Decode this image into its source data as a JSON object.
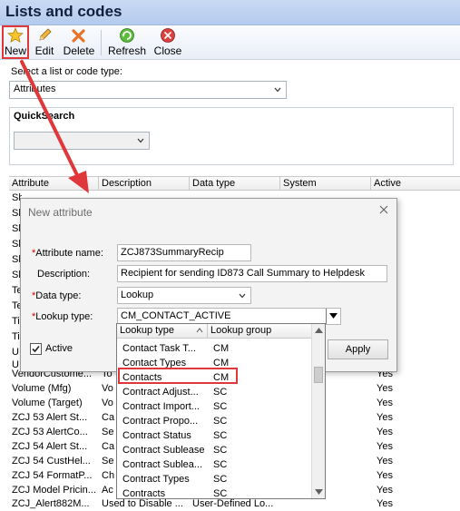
{
  "window": {
    "title": "Lists and codes"
  },
  "toolbar": {
    "new_label": "New",
    "edit_label": "Edit",
    "delete_label": "Delete",
    "refresh_label": "Refresh",
    "close_label": "Close",
    "icons": {
      "new": "star-icon",
      "edit": "pencil-icon",
      "delete": "cross-icon",
      "refresh": "refresh-icon",
      "close": "close-circle-icon"
    }
  },
  "selector": {
    "label": "Select a list or code type:",
    "value": "Attributes"
  },
  "quicksearch": {
    "title": "QuickSearch",
    "value": ""
  },
  "grid": {
    "columns": [
      "Attribute",
      "Description",
      "Data type",
      "System",
      "Active"
    ],
    "partial_rows": [
      {
        "attribute": "Sh",
        "description": ""
      },
      {
        "attribute": "Sh",
        "description": ""
      },
      {
        "attribute": "Sh",
        "description": ""
      },
      {
        "attribute": "Sh",
        "description": ""
      },
      {
        "attribute": "Sh",
        "description": ""
      },
      {
        "attribute": "Sh",
        "description": ""
      },
      {
        "attribute": "Te",
        "description": ""
      },
      {
        "attribute": "Te",
        "description": ""
      },
      {
        "attribute": "Ti",
        "description": ""
      },
      {
        "attribute": "Ti",
        "description": ""
      },
      {
        "attribute": "U",
        "description": ""
      },
      {
        "attribute": "U",
        "description": ""
      }
    ],
    "rows": [
      {
        "attribute": "VendorCustome...",
        "description": "To",
        "data_type": "",
        "system": "",
        "active": "Yes"
      },
      {
        "attribute": "Volume (Mfg)",
        "description": "Vo",
        "data_type": "",
        "system": "",
        "active": "Yes"
      },
      {
        "attribute": "Volume (Target)",
        "description": "Vo",
        "data_type": "",
        "system": "",
        "active": "Yes"
      },
      {
        "attribute": "ZCJ 53 Alert St...",
        "description": "Ca",
        "data_type": "",
        "system": "",
        "active": "Yes"
      },
      {
        "attribute": "ZCJ 53 AlertCo...",
        "description": "Se",
        "data_type": "",
        "system": "",
        "active": "Yes"
      },
      {
        "attribute": "ZCJ 54 Alert St...",
        "description": "Ca",
        "data_type": "",
        "system": "",
        "active": "Yes"
      },
      {
        "attribute": "ZCJ 54 CustHel...",
        "description": "Se",
        "data_type": "",
        "system": "",
        "active": "Yes"
      },
      {
        "attribute": "ZCJ 54 FormatP...",
        "description": "Ch",
        "data_type": "",
        "system": "",
        "active": "Yes"
      },
      {
        "attribute": "ZCJ Model Pricin...",
        "description": "Ac",
        "data_type": "",
        "system": "",
        "active": "Yes"
      },
      {
        "attribute": "ZCJ_Alert882M...",
        "description": "Used to Disable ...",
        "data_type": "User-Defined Lo...",
        "system": "",
        "active": "Yes"
      }
    ]
  },
  "dialog": {
    "title": "New attribute",
    "attribute_name_label": "Attribute name:",
    "attribute_name_value": "ZCJ873SummaryRecip",
    "description_label": "Description:",
    "description_value": "Recipient for sending ID873 Call Summary to Helpdesk",
    "data_type_label": "Data type:",
    "data_type_value": "Lookup",
    "lookup_type_label": "Lookup type:",
    "lookup_type_value": "CM_CONTACT_ACTIVE",
    "active_label": "Active",
    "active_checked": true,
    "apply_label": "Apply"
  },
  "lookup_list": {
    "columns": [
      "Lookup type",
      "Lookup group"
    ],
    "rows": [
      {
        "type": "Contact Task T...",
        "group": "CM"
      },
      {
        "type": "Contact Types",
        "group": "CM"
      },
      {
        "type": "Contacts",
        "group": "CM"
      },
      {
        "type": "Contract Adjust...",
        "group": "SC"
      },
      {
        "type": "Contract Import...",
        "group": "SC"
      },
      {
        "type": "Contract Propo...",
        "group": "SC"
      },
      {
        "type": "Contract Status",
        "group": "SC"
      },
      {
        "type": "Contract Sublease",
        "group": "SC"
      },
      {
        "type": "Contract Sublea...",
        "group": "SC"
      },
      {
        "type": "Contract Types",
        "group": "SC"
      },
      {
        "type": "Contracts",
        "group": "SC"
      }
    ],
    "highlight_row": "Contacts"
  },
  "colors": {
    "highlight": "#e0383a",
    "title_bg": "#b9cff0"
  }
}
